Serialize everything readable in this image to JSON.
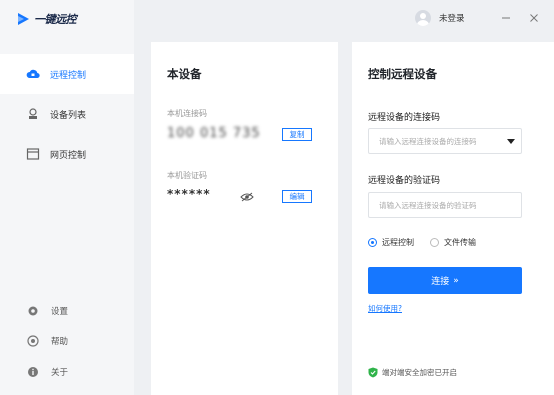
{
  "app": {
    "title": "一键远控"
  },
  "sidebar": {
    "items": [
      {
        "label": "远程控制",
        "icon": "cloud-remote-icon",
        "active": true
      },
      {
        "label": "设备列表",
        "icon": "device-list-icon",
        "active": false
      },
      {
        "label": "网页控制",
        "icon": "browser-window-icon",
        "active": false
      }
    ],
    "bottom": [
      {
        "label": "设置",
        "icon": "gear-icon"
      },
      {
        "label": "帮助",
        "icon": "help-icon"
      },
      {
        "label": "关于",
        "icon": "info-icon"
      }
    ]
  },
  "topbar": {
    "login_status": "未登录"
  },
  "local_device": {
    "title": "本设备",
    "code_label": "本机连接码",
    "code_value": "100 015 735",
    "copy_label": "复制",
    "verify_label": "本机验证码",
    "verify_value": "******",
    "edit_label": "编辑"
  },
  "remote": {
    "title": "控制远程设备",
    "code_label": "远程设备的连接码",
    "code_placeholder": "请输入远程连接设备的连接码",
    "verify_label": "远程设备的验证码",
    "verify_placeholder": "请输入远程连接设备的验证码",
    "mode_remote": "远程控制",
    "mode_file": "文件传输",
    "connect_label": "连接",
    "connect_arrow": "»",
    "help_label": "如何使用?",
    "secure_label": "端对端安全加密已开启"
  },
  "colors": {
    "accent": "#1677ff",
    "sidebar_bg": "#f5f6f8",
    "secure_green": "#2fb34a"
  }
}
